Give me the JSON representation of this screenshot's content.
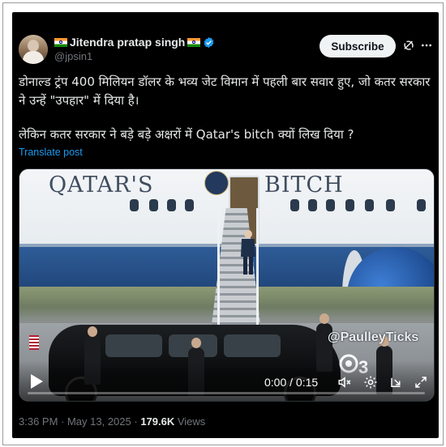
{
  "post": {
    "author_name": "Jitendra pratap singh",
    "author_handle": "@jpsin1",
    "subscribe_label": "Subscribe",
    "body_line1": "डोनाल्ड ट्रंप 400 मिलियन डॉलर के भव्य जेट विमान में पहली बार सवार हुए, जो कतर सरकार ने उन्हें \"उपहार\" में दिया है।",
    "body_line2": "लेकिन कतर सरकार ने बड़े बड़े अक्षरों में Qatar's bitch क्यों लिख दिया ?",
    "translate_label": "Translate post",
    "timestamp": "3:36 PM · May 13, 2025 ·",
    "views_count": "179.6K",
    "views_label": "Views"
  },
  "media": {
    "livery_left": "QATAR'S",
    "livery_right": "BITCH",
    "watermark": "@PaulleyTicks",
    "channel_number": "3",
    "time_display": "0:00 / 0:15",
    "progress_fraction": 0
  },
  "colors": {
    "background": "#000000",
    "text_primary": "#e7e9ea",
    "text_secondary": "#71767b",
    "link": "#1d9bf0",
    "subscribe_bg": "#eff3f4",
    "verified_badge": "#1d9bf0"
  },
  "icons": {
    "verified": "verified-badge-icon",
    "grok": "grok-icon",
    "more": "more-icon",
    "play": "play-icon",
    "volume": "volume-icon",
    "settings": "settings-icon",
    "pip": "picture-in-picture-icon",
    "fullscreen": "fullscreen-icon"
  }
}
